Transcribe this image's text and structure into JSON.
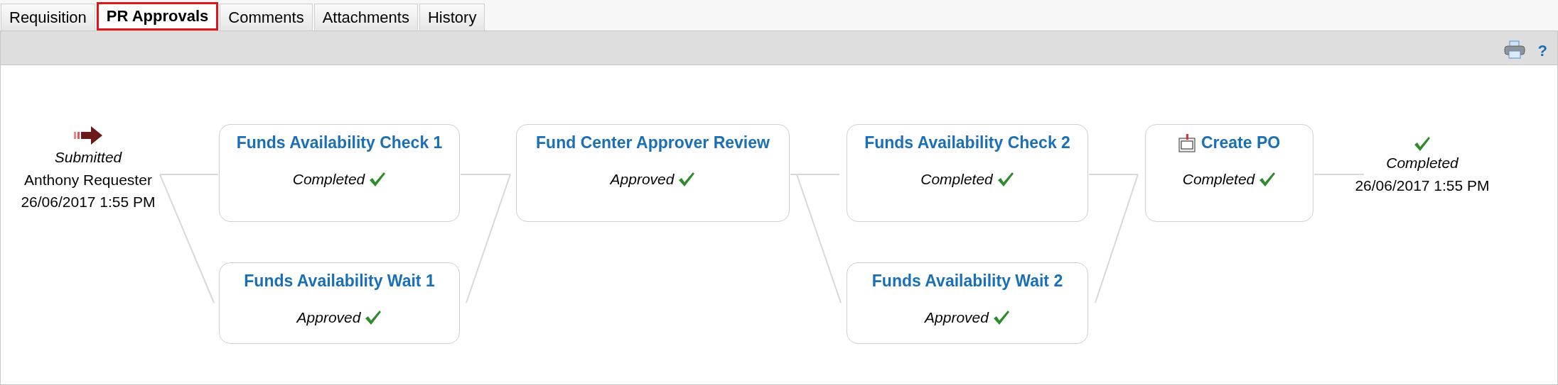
{
  "tabs": [
    {
      "label": "Requisition",
      "selected": false
    },
    {
      "label": "PR Approvals",
      "selected": true
    },
    {
      "label": "Comments",
      "selected": false
    },
    {
      "label": "Attachments",
      "selected": false
    },
    {
      "label": "History",
      "selected": false
    }
  ],
  "toolbar": {
    "help_label": "?"
  },
  "flow": {
    "start": {
      "status": "Submitted",
      "person": "Anthony Requester",
      "date": "26/06/2017 1:55 PM"
    },
    "stages": [
      {
        "nodes": [
          {
            "kind": "approval",
            "title": "Funds Availability Check 1",
            "status": "Completed",
            "checked": true
          },
          {
            "kind": "approval",
            "title": "Funds Availability Wait 1",
            "status": "Approved",
            "checked": true
          }
        ]
      },
      {
        "nodes": [
          {
            "kind": "approval",
            "title": "Fund Center Approver Review",
            "status": "Approved",
            "checked": true
          }
        ]
      },
      {
        "nodes": [
          {
            "kind": "approval",
            "title": "Funds Availability Check 2",
            "status": "Completed",
            "checked": true
          },
          {
            "kind": "approval",
            "title": "Funds Availability Wait 2",
            "status": "Approved",
            "checked": true
          }
        ]
      },
      {
        "nodes": [
          {
            "kind": "po",
            "title": "Create PO",
            "status": "Completed",
            "checked": true
          }
        ]
      }
    ],
    "end": {
      "status": "Completed",
      "date": "26/06/2017 1:55 PM",
      "checked": true
    }
  }
}
